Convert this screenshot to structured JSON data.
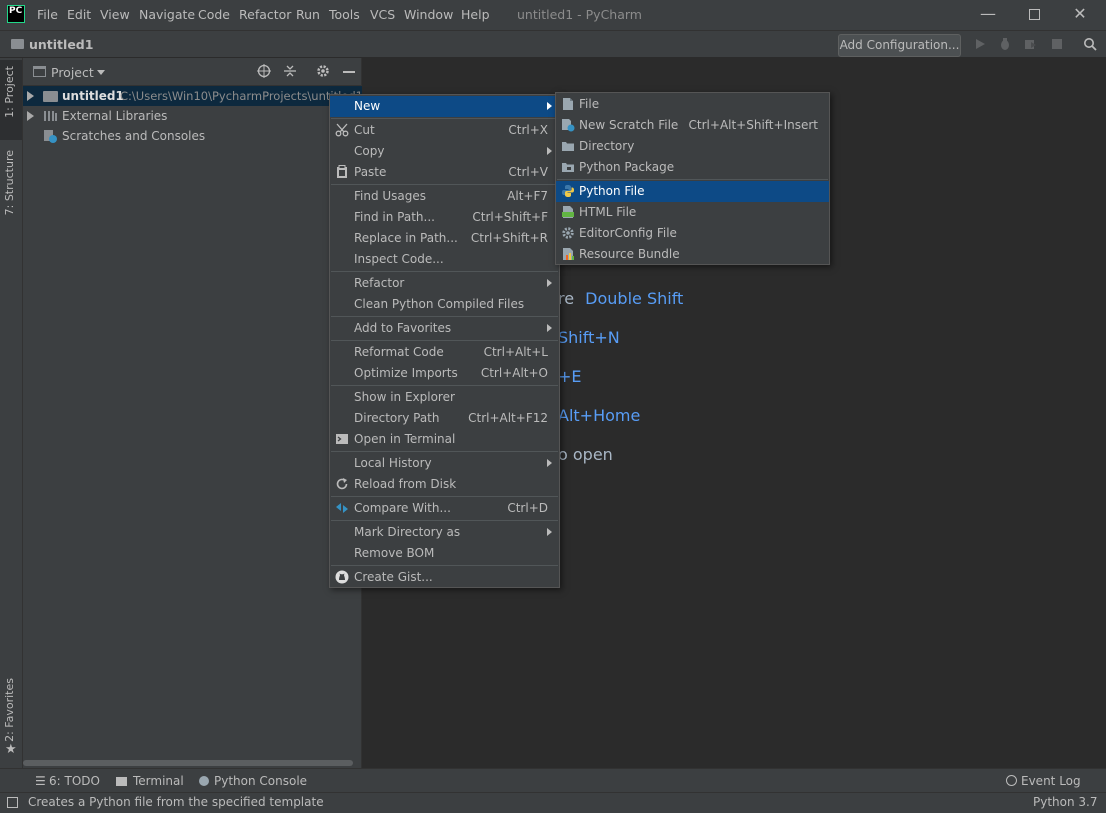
{
  "title_bar": {
    "logo": "PC",
    "menu": [
      "File",
      "Edit",
      "View",
      "Navigate",
      "Code",
      "Refactor",
      "Run",
      "Tools",
      "VCS",
      "Window",
      "Help"
    ],
    "title": "untitled1 - PyCharm"
  },
  "nav_bar": {
    "breadcrumb": "untitled1",
    "add_configuration": "Add Configuration..."
  },
  "left_stripe": {
    "tab1": "1: Project",
    "tab2": "7: Structure",
    "tab3": "2: Favorites"
  },
  "project_panel": {
    "header": "Project",
    "tree": [
      {
        "name": "untitled1",
        "path": "C:\\Users\\Win10\\PycharmProjects\\untitled1"
      },
      {
        "name": "External Libraries"
      },
      {
        "name": "Scratches and Consoles"
      }
    ]
  },
  "editor_hints": [
    {
      "gray": "re",
      "blue": "Double Shift"
    },
    {
      "gray": "",
      "blue": "Shift+N"
    },
    {
      "gray": "",
      "blue": "+E"
    },
    {
      "gray": "",
      "blue": "Alt+Home"
    },
    {
      "gray": "o open",
      "blue": ""
    }
  ],
  "context_menu": {
    "items": [
      {
        "label": "New",
        "shortcut": ""
      },
      {
        "label": "Cut",
        "shortcut": "Ctrl+X"
      },
      {
        "label": "Copy",
        "shortcut": ""
      },
      {
        "label": "Paste",
        "shortcut": "Ctrl+V"
      },
      {
        "label": "Find Usages",
        "shortcut": "Alt+F7"
      },
      {
        "label": "Find in Path...",
        "shortcut": "Ctrl+Shift+F"
      },
      {
        "label": "Replace in Path...",
        "shortcut": "Ctrl+Shift+R"
      },
      {
        "label": "Inspect Code...",
        "shortcut": ""
      },
      {
        "label": "Refactor",
        "shortcut": ""
      },
      {
        "label": "Clean Python Compiled Files",
        "shortcut": ""
      },
      {
        "label": "Add to Favorites",
        "shortcut": ""
      },
      {
        "label": "Reformat Code",
        "shortcut": "Ctrl+Alt+L"
      },
      {
        "label": "Optimize Imports",
        "shortcut": "Ctrl+Alt+O"
      },
      {
        "label": "Show in Explorer",
        "shortcut": ""
      },
      {
        "label": "Directory Path",
        "shortcut": "Ctrl+Alt+F12"
      },
      {
        "label": "Open in Terminal",
        "shortcut": ""
      },
      {
        "label": "Local History",
        "shortcut": ""
      },
      {
        "label": "Reload from Disk",
        "shortcut": ""
      },
      {
        "label": "Compare With...",
        "shortcut": "Ctrl+D"
      },
      {
        "label": "Mark Directory as",
        "shortcut": ""
      },
      {
        "label": "Remove BOM",
        "shortcut": ""
      },
      {
        "label": "Create Gist...",
        "shortcut": ""
      }
    ]
  },
  "new_submenu": {
    "items": [
      {
        "label": "File",
        "shortcut": ""
      },
      {
        "label": "New Scratch File",
        "shortcut": "Ctrl+Alt+Shift+Insert"
      },
      {
        "label": "Directory",
        "shortcut": ""
      },
      {
        "label": "Python Package",
        "shortcut": ""
      },
      {
        "label": "Python File",
        "shortcut": ""
      },
      {
        "label": "HTML File",
        "shortcut": ""
      },
      {
        "label": "EditorConfig File",
        "shortcut": ""
      },
      {
        "label": "Resource Bundle",
        "shortcut": ""
      }
    ]
  },
  "bottom_tabs": {
    "todo": "6: TODO",
    "terminal": "Terminal",
    "python_console": "Python Console",
    "event_log": "Event Log"
  },
  "status_bar": {
    "message": "Creates a Python file from the specified template",
    "interpreter": "Python 3.7"
  },
  "colors": {
    "background": "#2b2b2b",
    "panel": "#3c3f41",
    "selection": "#0d4a86",
    "accent_blue": "#589df6"
  }
}
